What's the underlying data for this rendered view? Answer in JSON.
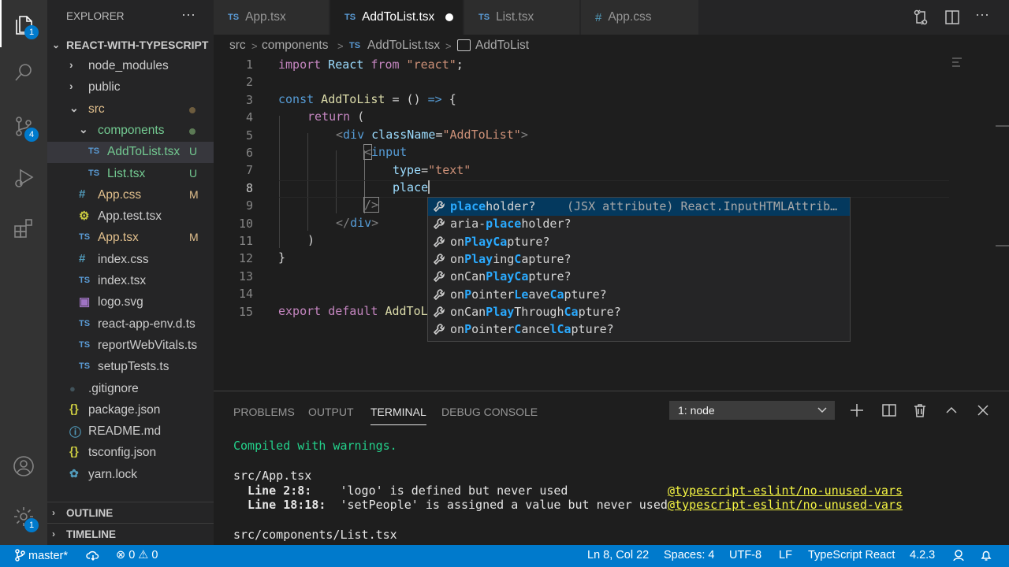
{
  "activity": {
    "explorer_badge": "1",
    "scm_badge": "4",
    "settings_badge": "1"
  },
  "sidebar": {
    "title": "EXPLORER",
    "more": "···",
    "project": "REACT-WITH-TYPESCRIPT",
    "items": [
      {
        "label": "node_modules",
        "icon": "chevron-right",
        "status": ""
      },
      {
        "label": "public",
        "icon": "chevron-right",
        "status": ""
      },
      {
        "label": "src",
        "icon": "chevron-down",
        "status": "dot-brown"
      },
      {
        "label": "components",
        "icon": "chevron-down",
        "status": "dot-green"
      },
      {
        "label": "AddToList.tsx",
        "icon": "TS",
        "status": "U"
      },
      {
        "label": "List.tsx",
        "icon": "TS",
        "status": "U"
      },
      {
        "label": "App.css",
        "icon": "#",
        "status": "M"
      },
      {
        "label": "App.test.tsx",
        "icon": "gear",
        "status": ""
      },
      {
        "label": "App.tsx",
        "icon": "TS",
        "status": "M"
      },
      {
        "label": "index.css",
        "icon": "#",
        "status": ""
      },
      {
        "label": "index.tsx",
        "icon": "TS",
        "status": ""
      },
      {
        "label": "logo.svg",
        "icon": "image",
        "status": ""
      },
      {
        "label": "react-app-env.d.ts",
        "icon": "TS",
        "status": ""
      },
      {
        "label": "reportWebVitals.ts",
        "icon": "TS",
        "status": ""
      },
      {
        "label": "setupTests.ts",
        "icon": "TS",
        "status": ""
      },
      {
        "label": ".gitignore",
        "icon": "dot",
        "status": ""
      },
      {
        "label": "package.json",
        "icon": "{}",
        "status": ""
      },
      {
        "label": "README.md",
        "icon": "info",
        "status": ""
      },
      {
        "label": "tsconfig.json",
        "icon": "{}",
        "status": ""
      },
      {
        "label": "yarn.lock",
        "icon": "yarn",
        "status": ""
      }
    ],
    "outline": "OUTLINE",
    "timeline": "TIMELINE"
  },
  "tabs": [
    {
      "label": "App.tsx",
      "icon": "TS"
    },
    {
      "label": "AddToList.tsx",
      "icon": "TS",
      "active": true
    },
    {
      "label": "List.tsx",
      "icon": "TS"
    },
    {
      "label": "App.css",
      "icon": "#"
    }
  ],
  "breadcrumb": {
    "a": "src",
    "b": "components",
    "c": "AddToList.tsx",
    "d": "AddToList",
    "sep": ">",
    "ts": "TS"
  },
  "code": {
    "line_numbers": [
      "1",
      "2",
      "3",
      "4",
      "5",
      "6",
      "7",
      "8",
      "9",
      "10",
      "11",
      "12",
      "13",
      "14",
      "15"
    ],
    "l1": {
      "a": "import",
      "b": " React ",
      "c": "from",
      "d": " \"react\"",
      "e": ";"
    },
    "l3": {
      "a": "const",
      "b": " AddToList",
      "c": " = () ",
      "d": "=>",
      "e": " {"
    },
    "l4": {
      "a": "return",
      "b": " ("
    },
    "l5": {
      "a": "<",
      "b": "div",
      "c": " className",
      "d": "=",
      "e": "\"AddToList\"",
      "f": ">"
    },
    "l6": {
      "a": "<",
      "b": "input"
    },
    "l7": {
      "a": "type",
      "b": "=",
      "c": "\"text\""
    },
    "l8": {
      "a": "place"
    },
    "l9": {
      "a": "/>"
    },
    "l10": {
      "a": "</",
      "b": "div",
      "c": ">"
    },
    "l11": {
      "a": ")"
    },
    "l12": {
      "a": "}"
    },
    "l15": {
      "a": "export",
      "b": " ",
      "c": "default",
      "d": " AddToL"
    }
  },
  "suggest": [
    {
      "pre": "",
      "hl": "place",
      "post": "holder?",
      "detail": "(JSX attribute) React.InputHTMLAttrib…"
    },
    {
      "pre": "aria-",
      "hl": "place",
      "post": "holder?",
      "detail": ""
    },
    {
      "parts": [
        "on",
        "P",
        "",
        "la",
        "",
        "y",
        "",
        "C",
        "",
        "a",
        "pture?"
      ]
    },
    {
      "parts": [
        "on",
        "P",
        "",
        "la",
        "",
        "y",
        "ing",
        "C",
        "apture",
        "",
        "?"
      ]
    },
    {
      "parts": [
        "onCan",
        "P",
        "",
        "la",
        "",
        "y",
        "",
        "C",
        "",
        "a",
        "pture?"
      ]
    },
    {
      "parts": [
        "on",
        "P",
        "ointer",
        "L",
        "",
        "e",
        "ave",
        "C",
        "",
        "a",
        "pture?"
      ]
    },
    {
      "parts": [
        "onCan",
        "P",
        "",
        "la",
        "",
        "y",
        "Through",
        "C",
        "",
        "a",
        "pture?"
      ]
    },
    {
      "parts": [
        "on",
        "P",
        "ointer",
        "C",
        "ance",
        "l",
        "",
        "C",
        "",
        "a",
        "pture?"
      ]
    }
  ],
  "panel": {
    "tabs": [
      "PROBLEMS",
      "OUTPUT",
      "TERMINAL",
      "DEBUG CONSOLE"
    ],
    "terminal_select": "1: node",
    "lines": {
      "t1": "Compiled with warnings.",
      "t2": "src/App.tsx",
      "t3a": "  Line 2:8:",
      "t3b": "    'logo' is defined but never used",
      "t3c": "@typescript-eslint/no-unused-vars",
      "t4a": "  Line 18:18:",
      "t4b": "  'setPeople' is assigned a value but never used",
      "t4c": "@typescript-eslint/no-unused-vars",
      "t5": "src/components/List.tsx"
    }
  },
  "status": {
    "branch": "master*",
    "errors": "0",
    "warnings": "0",
    "position": "Ln 8, Col 22",
    "spaces": "Spaces: 4",
    "encoding": "UTF-8",
    "eol": "LF",
    "language": "TypeScript React",
    "version": "4.2.3"
  },
  "colors": {
    "accent": "#007acc",
    "ts_icon": "#5a9bd5",
    "untracked": "#73c991",
    "modified": "#e2c08d",
    "suggest_highlight": "#2aaaff"
  }
}
